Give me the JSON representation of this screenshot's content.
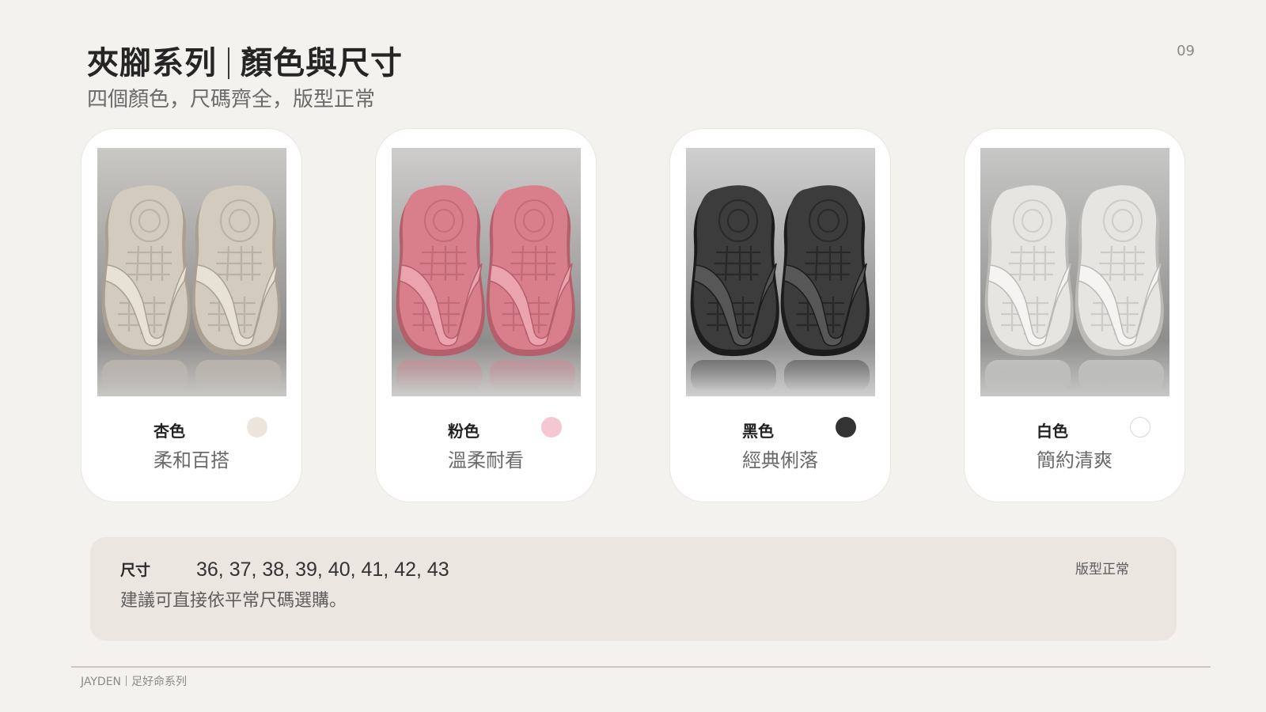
{
  "header": {
    "title_part1": "夾腳系列",
    "title_part2": "顏色與尺寸",
    "subtitle": "四個顏色，尺碼齊全，版型正常",
    "page_number": "09"
  },
  "colors": [
    {
      "name": "杏色",
      "description": "柔和百搭",
      "swatch": "#ece5db",
      "sandal_fill": "#d3cbbd",
      "sandal_shade": "#a9a092",
      "sandal_light": "#e7e1d6",
      "backdrop_top": "#c9c8c5",
      "backdrop_bottom": "#8d8c8a"
    },
    {
      "name": "粉色",
      "description": "溫柔耐看",
      "swatch": "#f4c7d1",
      "sandal_fill": "#d97f8c",
      "sandal_shade": "#b45f6c",
      "sandal_light": "#eba4ae",
      "backdrop_top": "#cfcdcc",
      "backdrop_bottom": "#8f8d8c"
    },
    {
      "name": "黑色",
      "description": "經典俐落",
      "swatch": "#333333",
      "sandal_fill": "#3c3c3c",
      "sandal_shade": "#1c1c1c",
      "sandal_light": "#575757",
      "backdrop_top": "#cfcfcf",
      "backdrop_bottom": "#8b8b8b"
    },
    {
      "name": "白色",
      "description": "簡約清爽",
      "swatch": "#ffffff",
      "sandal_fill": "#e6e5e2",
      "sandal_shade": "#bcbab6",
      "sandal_light": "#f5f4f2",
      "backdrop_top": "#c7c7c6",
      "backdrop_bottom": "#8e8e8d"
    }
  ],
  "sizes": {
    "label": "尺寸",
    "values": "36, 37, 38, 39, 40, 41, 42, 43",
    "note": "建議可直接依平常尺碼選購。",
    "fit_tag": "版型正常"
  },
  "footer": {
    "brand": "JAYDEN",
    "series": "足好命系列"
  }
}
